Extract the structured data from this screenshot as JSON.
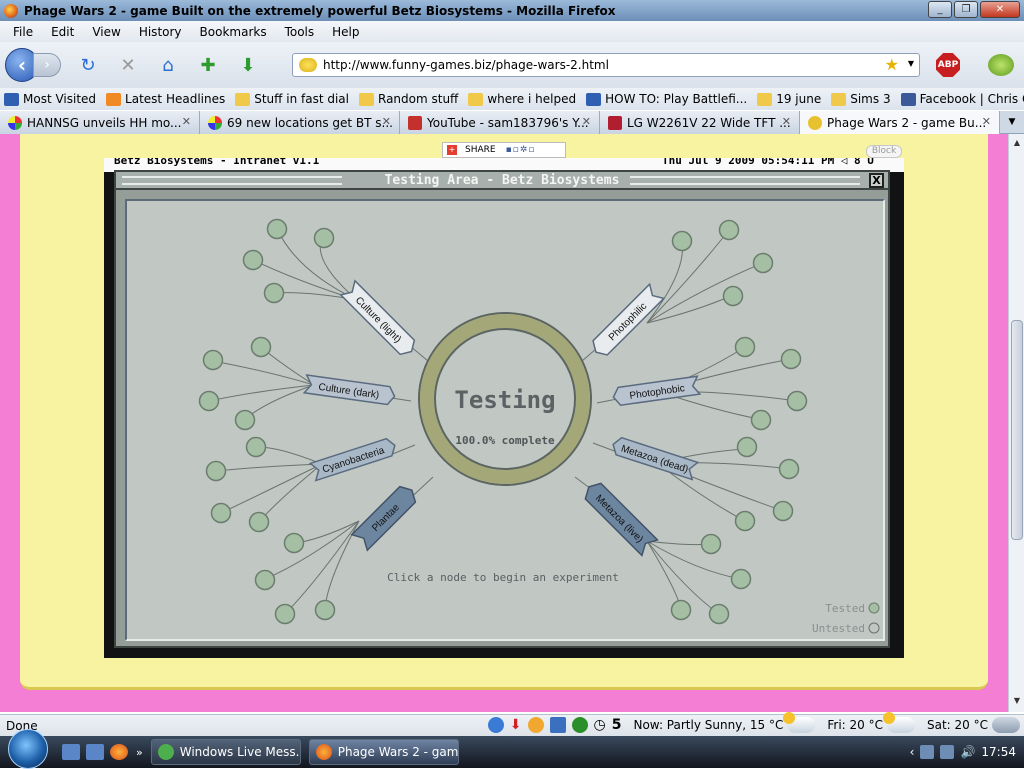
{
  "window": {
    "title": "Phage Wars 2 - game Built on the extremely powerful Betz Biosystems - Mozilla Firefox"
  },
  "menu": [
    "File",
    "Edit",
    "View",
    "History",
    "Bookmarks",
    "Tools",
    "Help"
  ],
  "url": "http://www.funny-games.biz/phage-wars-2.html",
  "abp_label": "ABP",
  "bookmarks": [
    {
      "label": "Most Visited",
      "icon": "most-visited-icon"
    },
    {
      "label": "Latest Headlines",
      "icon": "rss-icon"
    },
    {
      "label": "Stuff in fast dial",
      "icon": "folder-icon"
    },
    {
      "label": "Random stuff",
      "icon": "folder-icon"
    },
    {
      "label": "where i helped",
      "icon": "folder-icon"
    },
    {
      "label": "HOW TO: Play Battlefi...",
      "icon": "howto-icon"
    },
    {
      "label": "19 june",
      "icon": "folder-icon"
    },
    {
      "label": "Sims 3",
      "icon": "folder-icon"
    },
    {
      "label": "Facebook | Chris Cook",
      "icon": "facebook-icon"
    }
  ],
  "tabs": [
    {
      "label": "HANNSG unveils HH mo...",
      "active": false
    },
    {
      "label": "69 new locations get BT s...",
      "active": false
    },
    {
      "label": "YouTube - sam183796's Y...",
      "active": false
    },
    {
      "label": "LG W2261V 22 Wide TFT ...",
      "active": false
    },
    {
      "label": "Phage Wars 2 - game Bu...",
      "active": true
    }
  ],
  "share": {
    "label": "SHARE",
    "block": "Block"
  },
  "intranet": {
    "left": "Betz Biosystems - Intranet v1.1",
    "right": "Thu Jul 9 2009 05:54:11 PM  ◁ 8 U"
  },
  "dialog": {
    "title": "Testing Area - Betz Biosystems",
    "close": "X",
    "center_title": "Testing",
    "center_progress": "100.0% complete",
    "instruction": "Click a node to begin an experiment",
    "legend_tested": "Tested",
    "legend_untested": "Untested",
    "categories": [
      "Culture (light)",
      "Culture (dark)",
      "Cyanobacteria",
      "Plantae",
      "Photophilic",
      "Photophobic",
      "Metazoa (dead)",
      "Metazoa (live)"
    ]
  },
  "status": {
    "done": "Done",
    "counter": "5",
    "now": "Now: Partly Sunny, 15 °C",
    "fri": "Fri: 20 °C",
    "sat": "Sat: 20 °C"
  },
  "taskbar": {
    "items": [
      {
        "label": "Windows Live Mess...",
        "active": false
      },
      {
        "label": "Phage Wars 2 - gam...",
        "active": true
      }
    ],
    "clock": "17:54"
  },
  "colors": {
    "page_pink": "#f47ed4",
    "page_yellow": "#f7f3a0",
    "tested": "#a5bfa5",
    "untested": "#c1c7c2",
    "ring": "#a4a778"
  }
}
